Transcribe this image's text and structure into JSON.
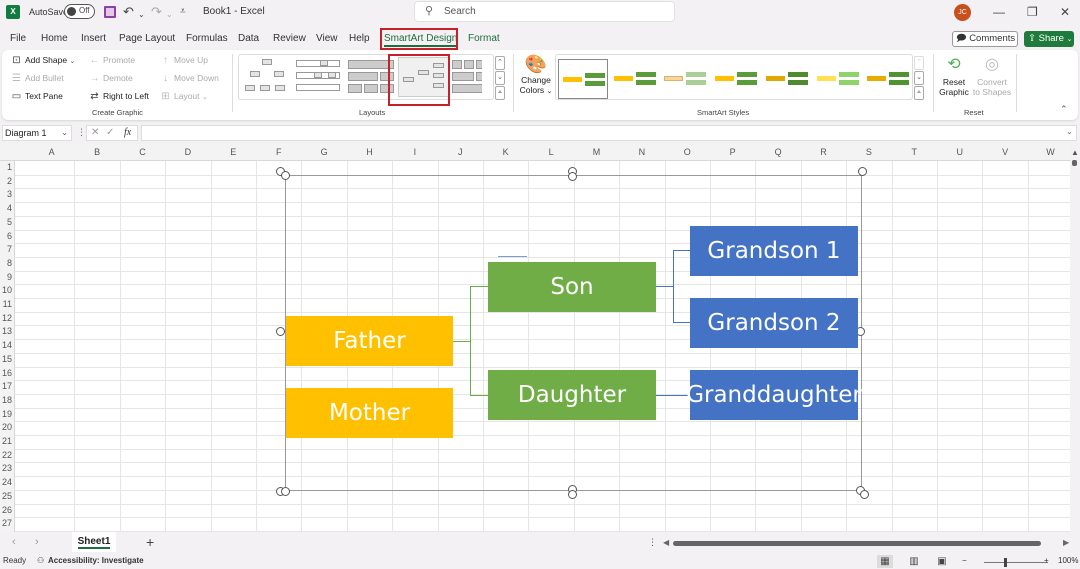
{
  "titlebar": {
    "app_icon": "excel-logo",
    "autosave_label": "AutoSave",
    "autosave_state": "Off",
    "doc_title": "Book1  -  Excel",
    "search_placeholder": "Search",
    "avatar_initials": "JC",
    "minimize": "—",
    "restore": "❐",
    "close": "✕",
    "undo": "↶",
    "redo": "↷",
    "customize": "⩡"
  },
  "menu": {
    "tabs": [
      "File",
      "Home",
      "Insert",
      "Page Layout",
      "Formulas",
      "Data",
      "Review",
      "View",
      "Help",
      "SmartArt Design",
      "Format"
    ],
    "active_tab": "SmartArt Design",
    "comments_label": "Comments",
    "share_label": "Share"
  },
  "ribbon": {
    "create_graphic": {
      "label": "Create Graphic",
      "add_shape": "Add Shape",
      "add_bullet": "Add Bullet",
      "text_pane": "Text Pane",
      "promote": "Promote",
      "demote": "Demote",
      "right_to_left": "Right to Left",
      "move_up": "Move Up",
      "move_down": "Move Down",
      "layout": "Layout"
    },
    "layouts": {
      "label": "Layouts",
      "selected_index": 3
    },
    "smartart_styles": {
      "label": "SmartArt Styles",
      "change_colors_line1": "Change",
      "change_colors_line2": "Colors",
      "selected_index": 0
    },
    "reset": {
      "label": "Reset",
      "reset_graphic_line1": "Reset",
      "reset_graphic_line2": "Graphic",
      "convert_line1": "Convert",
      "convert_line2": "to Shapes"
    }
  },
  "formula_bar": {
    "name_box": "Diagram 1",
    "fx": "fx",
    "cancel": "✕",
    "enter": "✓",
    "value": ""
  },
  "grid": {
    "columns": [
      "A",
      "B",
      "C",
      "D",
      "E",
      "F",
      "G",
      "H",
      "I",
      "J",
      "K",
      "L",
      "M",
      "N",
      "O",
      "P",
      "Q",
      "R",
      "S",
      "T",
      "U",
      "V",
      "W"
    ],
    "rows": [
      "1",
      "2",
      "3",
      "4",
      "5",
      "6",
      "7",
      "8",
      "9",
      "10",
      "11",
      "12",
      "13",
      "14",
      "15",
      "16",
      "17",
      "18",
      "19",
      "20",
      "21",
      "22",
      "23",
      "24",
      "25",
      "26",
      "27"
    ]
  },
  "smartart": {
    "nodes": {
      "father": "Father",
      "mother": "Mother",
      "son": "Son",
      "daughter": "Daughter",
      "grandson1": "Grandson 1",
      "grandson2": "Grandson 2",
      "granddaughter": "Granddaughter"
    },
    "colors": {
      "level1": "#ffc000",
      "level2": "#70ad47",
      "level3": "#4472c4"
    }
  },
  "sheets": {
    "tabs": [
      "Sheet1"
    ],
    "active": "Sheet1",
    "add": "+"
  },
  "status": {
    "ready": "Ready",
    "accessibility": "Accessibility: Investigate",
    "zoom": "100%",
    "zoom_minus": "−",
    "zoom_plus": "+"
  },
  "accent_colors": {
    "excel_green": "#1e6f3b",
    "highlight_red": "#c8202a"
  }
}
